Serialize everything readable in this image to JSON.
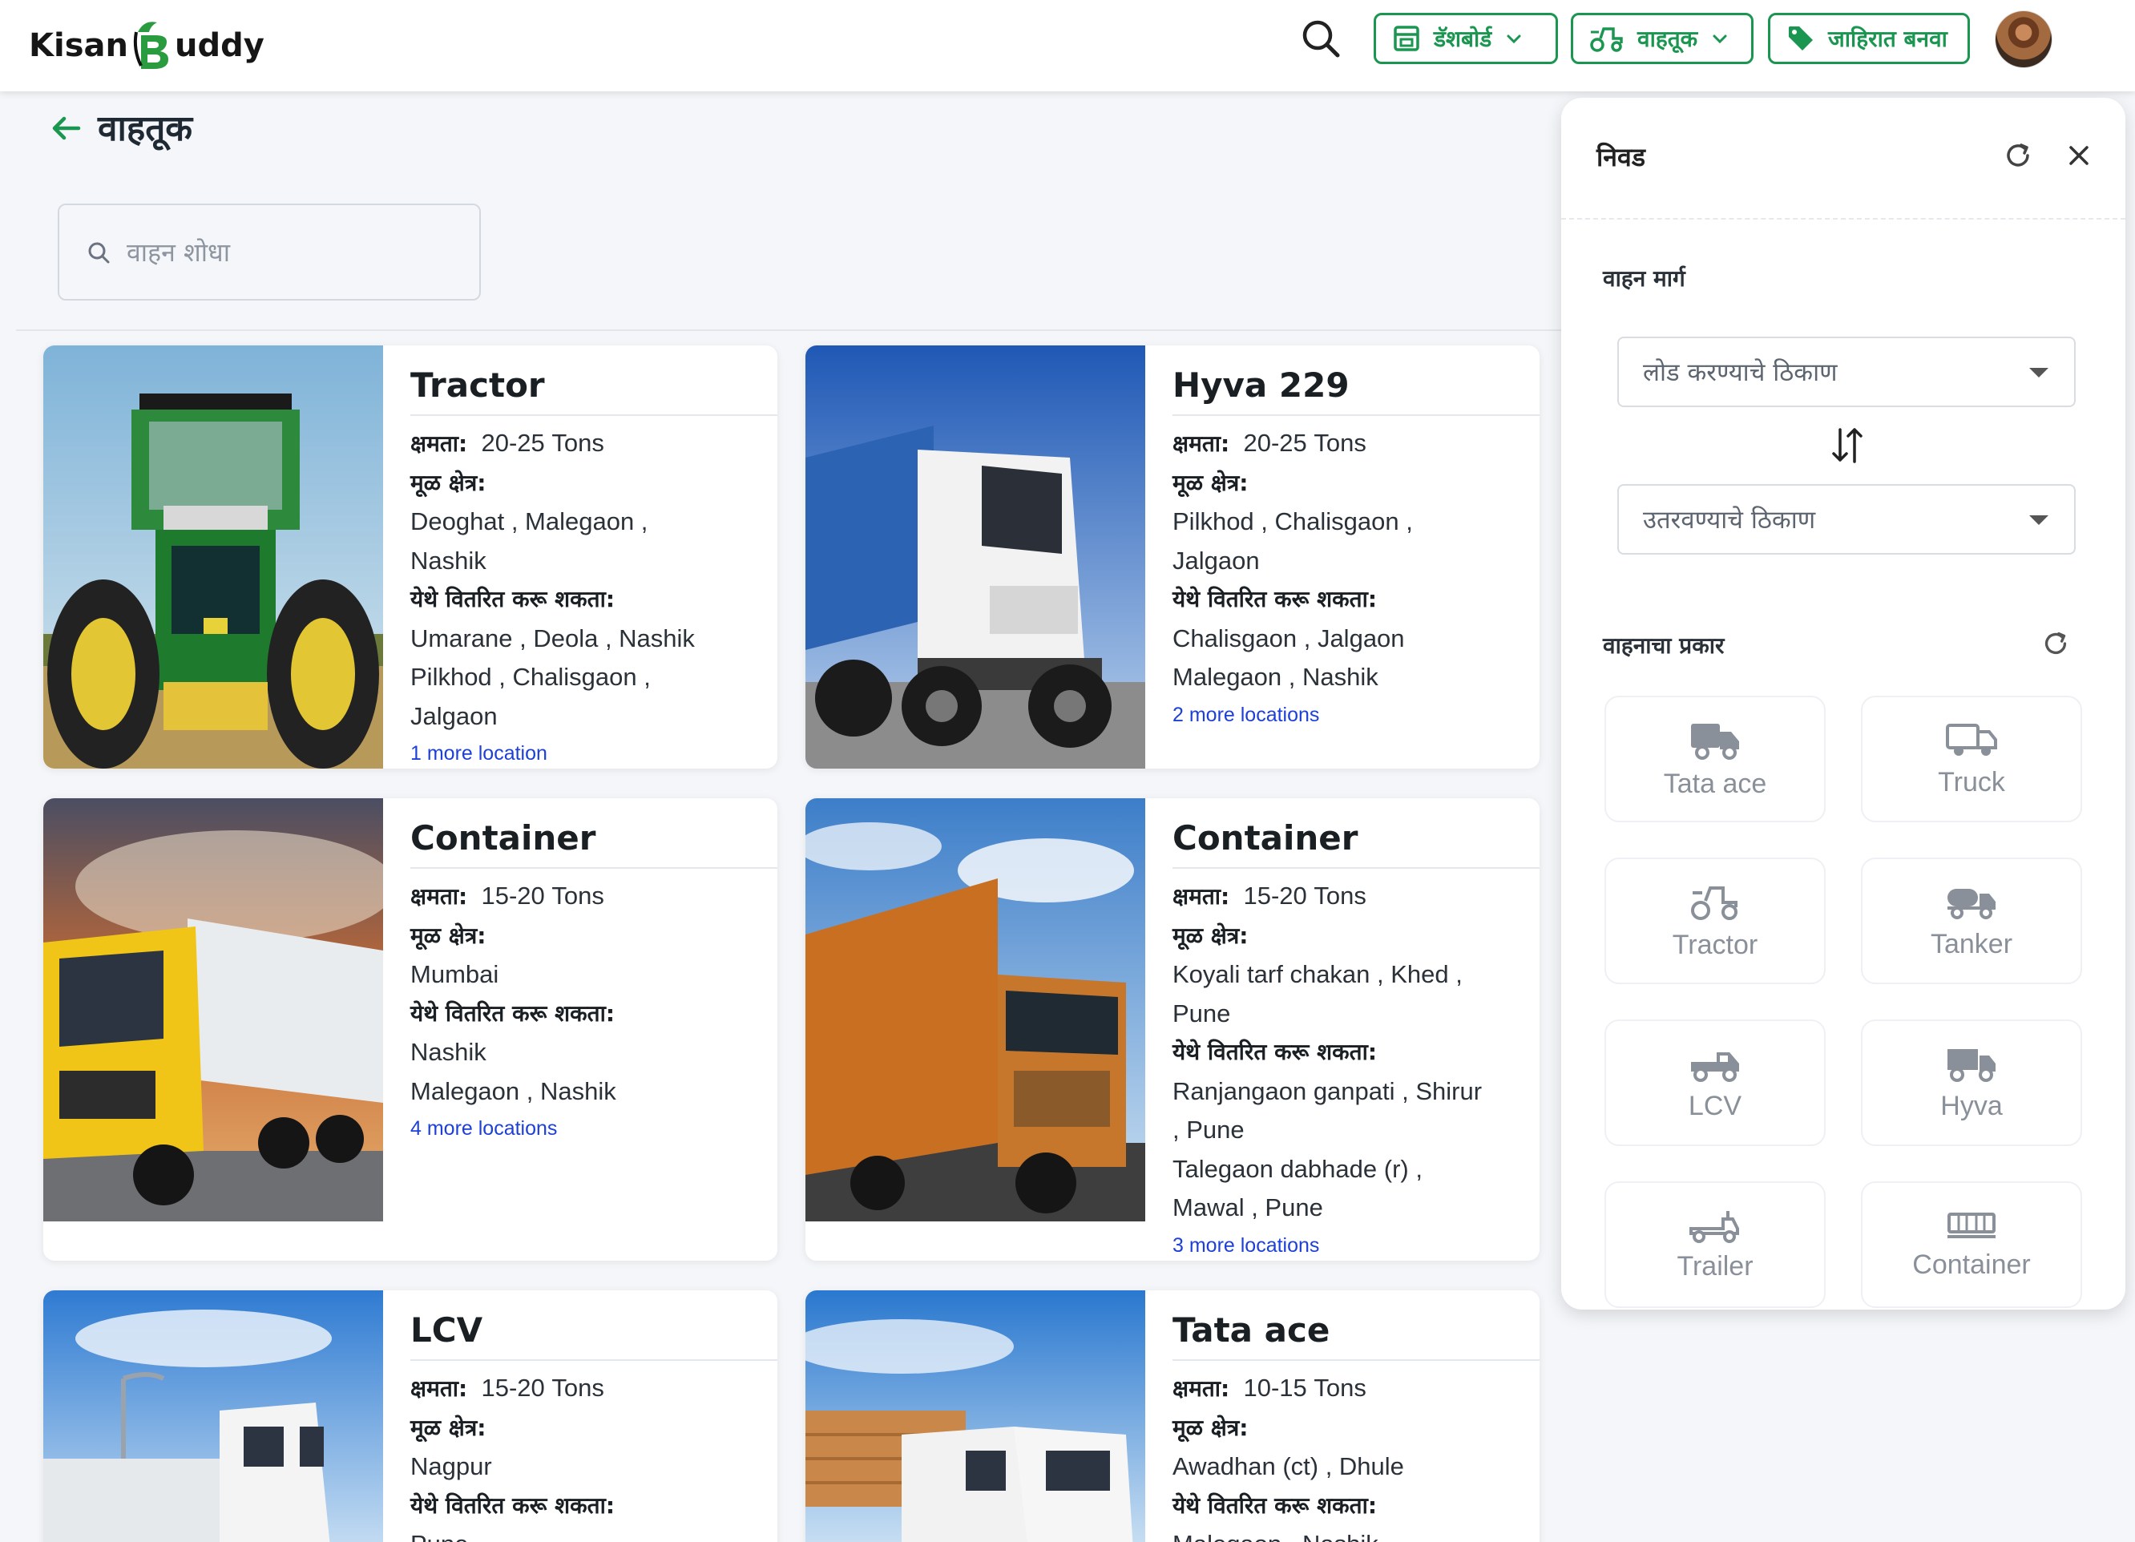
{
  "header": {
    "logo_left": "Kisan",
    "logo_right": "uddy",
    "dashboard_label": "डॅशबोर्ड",
    "vehicles_label": "वाहतूक",
    "post_ad_label": "जाहिरात बनवा"
  },
  "page": {
    "title": "वाहतूक",
    "search_placeholder": "वाहन शोधा"
  },
  "card_labels": {
    "capacity": "क्षमता:",
    "origin": "मूळ क्षेत्र:",
    "deliver": "येथे वितरित करू शकता:"
  },
  "cards": [
    {
      "title": "Tractor",
      "capacity": "20-25 Tons",
      "origin_lines": [
        "Deoghat , Malegaon ,",
        "Nashik"
      ],
      "deliver_lines": [
        "Umarane , Deola , Nashik",
        "Pilkhod , Chalisgaon ,",
        "Jalgaon"
      ],
      "more": "1 more location"
    },
    {
      "title": "Hyva 229",
      "capacity": "20-25 Tons",
      "origin_lines": [
        "Pilkhod , Chalisgaon ,",
        "Jalgaon"
      ],
      "deliver_lines": [
        "Chalisgaon , Jalgaon",
        "Malegaon , Nashik"
      ],
      "more": "2 more locations"
    },
    {
      "title": "Container",
      "capacity": "15-20 Tons",
      "origin_lines": [
        "Mumbai"
      ],
      "deliver_lines": [
        "Nashik",
        "Malegaon , Nashik"
      ],
      "more": "4 more locations"
    },
    {
      "title": "Container",
      "capacity": "15-20 Tons",
      "origin_lines": [
        "Koyali tarf chakan , Khed ,",
        "Pune"
      ],
      "deliver_lines": [
        "Ranjangaon ganpati , Shirur",
        ", Pune",
        "Talegaon dabhade (r) ,",
        "Mawal , Pune"
      ],
      "more": "3 more locations"
    },
    {
      "title": "LCV",
      "capacity": "15-20 Tons",
      "origin_lines": [
        "Nagpur"
      ],
      "deliver_lines": [
        "Pune"
      ],
      "more": ""
    },
    {
      "title": "Tata ace",
      "capacity": "10-15 Tons",
      "origin_lines": [
        "Awadhan (ct) , Dhule"
      ],
      "deliver_lines": [
        "Malegaon , Nashik"
      ],
      "more": ""
    }
  ],
  "filter": {
    "title": "निवड",
    "route_label": "वाहन मार्ग",
    "loading_placeholder": "लोड करण्याचे ठिकाण",
    "unloading_placeholder": "उतरवण्याचे ठिकाण",
    "type_label": "वाहनाचा प्रकार",
    "types": [
      {
        "label": "Tata ace",
        "icon": "delivery-truck-icon"
      },
      {
        "label": "Truck",
        "icon": "truck-icon"
      },
      {
        "label": "Tractor",
        "icon": "tractor-icon"
      },
      {
        "label": "Tanker",
        "icon": "tanker-icon"
      },
      {
        "label": "LCV",
        "icon": "pickup-truck-icon"
      },
      {
        "label": "Hyva",
        "icon": "dump-truck-icon"
      },
      {
        "label": "Trailer",
        "icon": "trailer-icon"
      },
      {
        "label": "Container",
        "icon": "container-icon"
      }
    ]
  },
  "colors": {
    "brand_green": "#1a9650",
    "link_blue": "#1d40d8",
    "icon_gray": "#8a9099"
  }
}
